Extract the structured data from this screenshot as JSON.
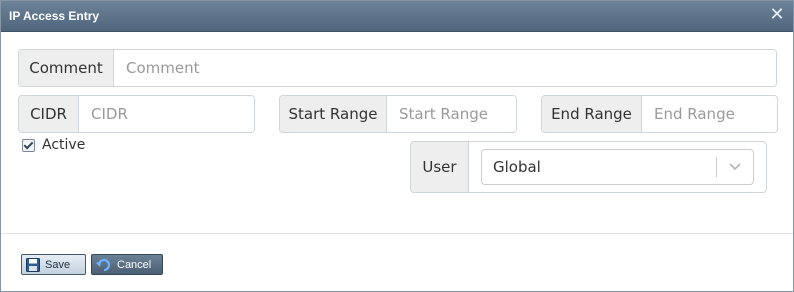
{
  "dialog": {
    "title": "IP Access Entry",
    "close_glyph": "✕"
  },
  "fields": {
    "comment": {
      "label": "Comment",
      "placeholder": "Comment",
      "value": ""
    },
    "cidr": {
      "label": "CIDR",
      "placeholder": "CIDR",
      "value": ""
    },
    "start_range": {
      "label": "Start Range",
      "placeholder": "Start Range",
      "value": ""
    },
    "end_range": {
      "label": "End Range",
      "placeholder": "End Range",
      "value": ""
    },
    "active": {
      "label": "Active",
      "checked": true
    },
    "user": {
      "label": "User",
      "selected": "Global"
    }
  },
  "buttons": {
    "save": {
      "label": "Save",
      "icon": "floppy-disk-icon"
    },
    "cancel": {
      "label": "Cancel",
      "icon": "undo-arrow-icon"
    }
  },
  "colors": {
    "titlebar": "#5a7086",
    "addon_bg": "#eeeeee",
    "border": "#cfd5db"
  }
}
